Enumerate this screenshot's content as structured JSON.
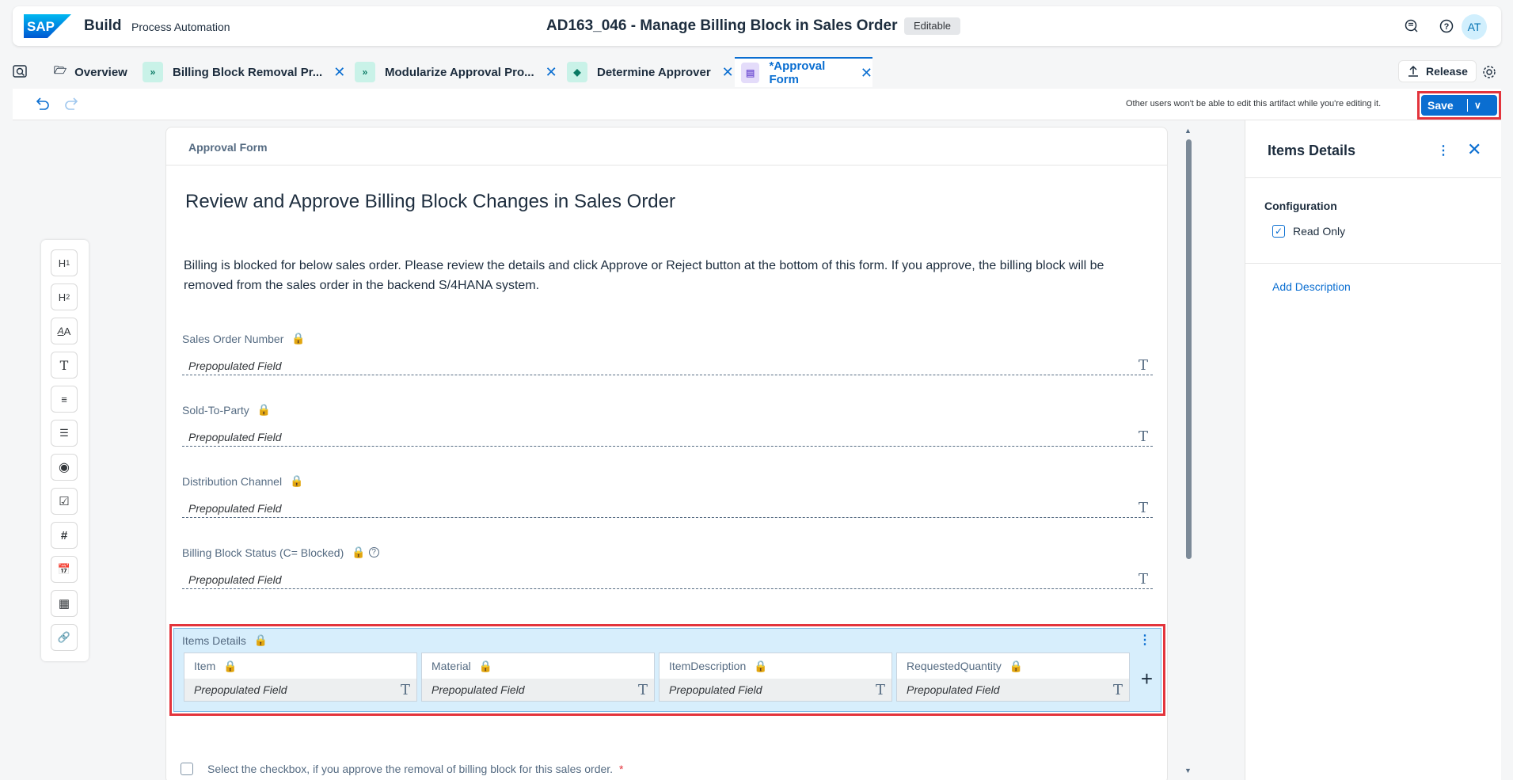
{
  "shell": {
    "brand": "Build",
    "product": "Process Automation",
    "title": "AD163_046 - Manage Billing Block in Sales Order",
    "badge": "Editable",
    "avatar": "AT",
    "icons": [
      "feedback-icon",
      "help-icon"
    ]
  },
  "tabs": [
    {
      "label": "Overview",
      "icon": "folder-icon"
    },
    {
      "label": "Billing Block Removal Pr...",
      "icon": "process-icon"
    },
    {
      "label": "Modularize Approval Pro...",
      "icon": "process-icon"
    },
    {
      "label": "Determine Approver",
      "icon": "decision-icon"
    },
    {
      "label": "*Approval Form",
      "icon": "form-icon",
      "active": true
    }
  ],
  "tabbar": {
    "release_label": "Release"
  },
  "toolbar": {
    "edit_note": "Other users won't be able to edit this artifact while you're editing it.",
    "save_label": "Save"
  },
  "palette": [
    "H1",
    "H2",
    "paragraph-style",
    "text",
    "paragraph",
    "checklist",
    "radio",
    "checkbox",
    "number",
    "date",
    "table",
    "link"
  ],
  "form": {
    "header": "Approval Form",
    "title": "Review and Approve Billing Block Changes in Sales Order",
    "description": "Billing is blocked for below sales order. Please review the details and click Approve or Reject button at the bottom of this form. If you approve, the billing block will be removed from the sales order in the backend S/4HANA system.",
    "placeholder": "Prepopulated Field",
    "text_glyph": "T",
    "fields": [
      {
        "label": "Sales Order Number"
      },
      {
        "label": "Sold-To-Party"
      },
      {
        "label": "Distribution Channel"
      },
      {
        "label": "Billing Block Status (C= Blocked)",
        "help": true
      }
    ],
    "items": {
      "label": "Items Details",
      "columns": [
        "Item",
        "Material",
        "ItemDescription",
        "RequestedQuantity"
      ]
    },
    "approve_text": "Select the checkbox, if you approve the removal of billing block for this sales order.",
    "required_mark": "*"
  },
  "panel": {
    "title": "Items Details",
    "section": "Configuration",
    "read_only_label": "Read Only",
    "read_only_checked": true,
    "add_description": "Add Description"
  },
  "colors": {
    "accent": "#0a6ed1",
    "highlight": "#e3343c",
    "table_bg": "#d7eefc"
  }
}
